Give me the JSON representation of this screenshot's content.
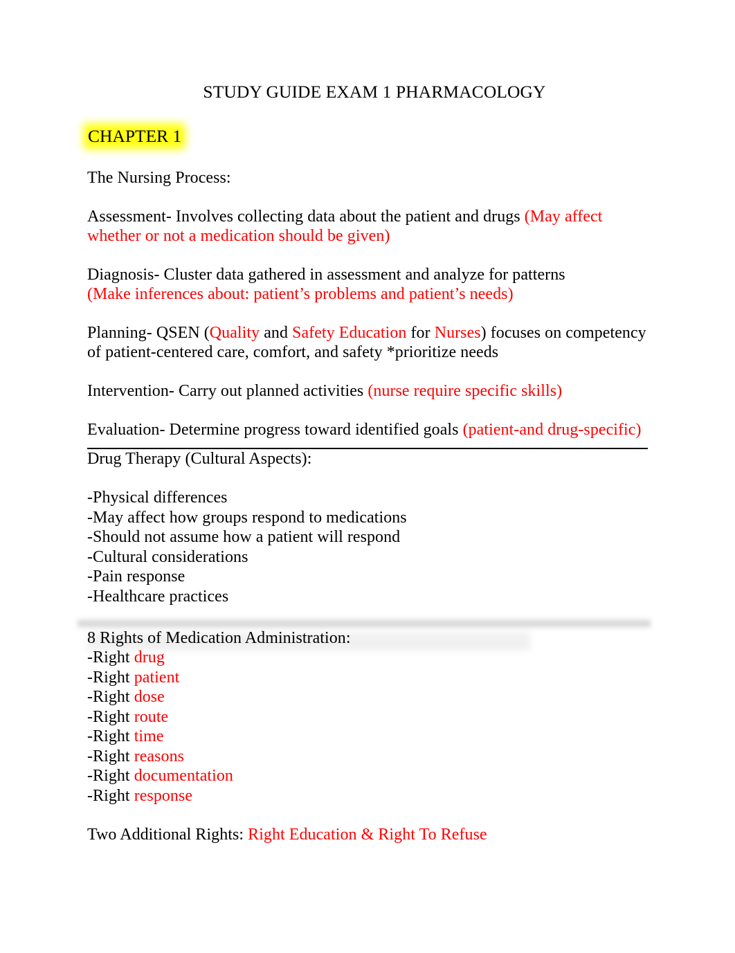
{
  "document": {
    "title": "STUDY GUIDE EXAM 1 PHARMACOLOGY",
    "chapter_heading": "CHAPTER 1",
    "highlight_color": "#ffff00",
    "accent_color": "#ff0000",
    "text_color": "#000000",
    "background_color": "#ffffff"
  },
  "nursing_process": {
    "heading": "The Nursing Process:",
    "steps": [
      {
        "black_1": "Assessment-  Involves collecting data about the patient and drugs ",
        "red_1": "(May affect whether or not a medication should be given)"
      },
      {
        "black_1": "Diagnosis- Cluster data gathered in assessment and analyze for patterns",
        "red_1": "(Make inferences about: patient’s problems and patient’s needs)"
      },
      {
        "black_1": "Planning-   QSEN (",
        "red_1": "Quality",
        "black_2": " and ",
        "red_2": "Safety Education",
        "black_3": " for ",
        "red_3": "Nurses",
        "black_4": ") focuses on competency of patient-centered care, comfort, and safety *prioritize needs"
      },
      {
        "black_1": "Intervention-   Carry out planned activities ",
        "red_1": "(nurse require specific skills)"
      },
      {
        "black_1": "Evaluation-  Determine progress toward identified goals ",
        "red_1": "(patient-and drug-specific)"
      }
    ]
  },
  "drug_therapy": {
    "heading": "Drug Therapy (Cultural Aspects):",
    "items": [
      "-Physical differences",
      "-May affect how groups respond to medications",
      "-Should not assume how a patient will respond",
      "-Cultural considerations",
      "-Pain response",
      "-Healthcare practices"
    ]
  },
  "rights": {
    "heading": "8 Rights of Medication Administration:",
    "prefix": "-Right ",
    "items": [
      "drug",
      "patient",
      "dose",
      "route",
      "time",
      "reasons",
      "documentation",
      "response"
    ],
    "additional_label": "Two Additional Rights: ",
    "additional_value": "Right Education & Right To Refuse"
  }
}
